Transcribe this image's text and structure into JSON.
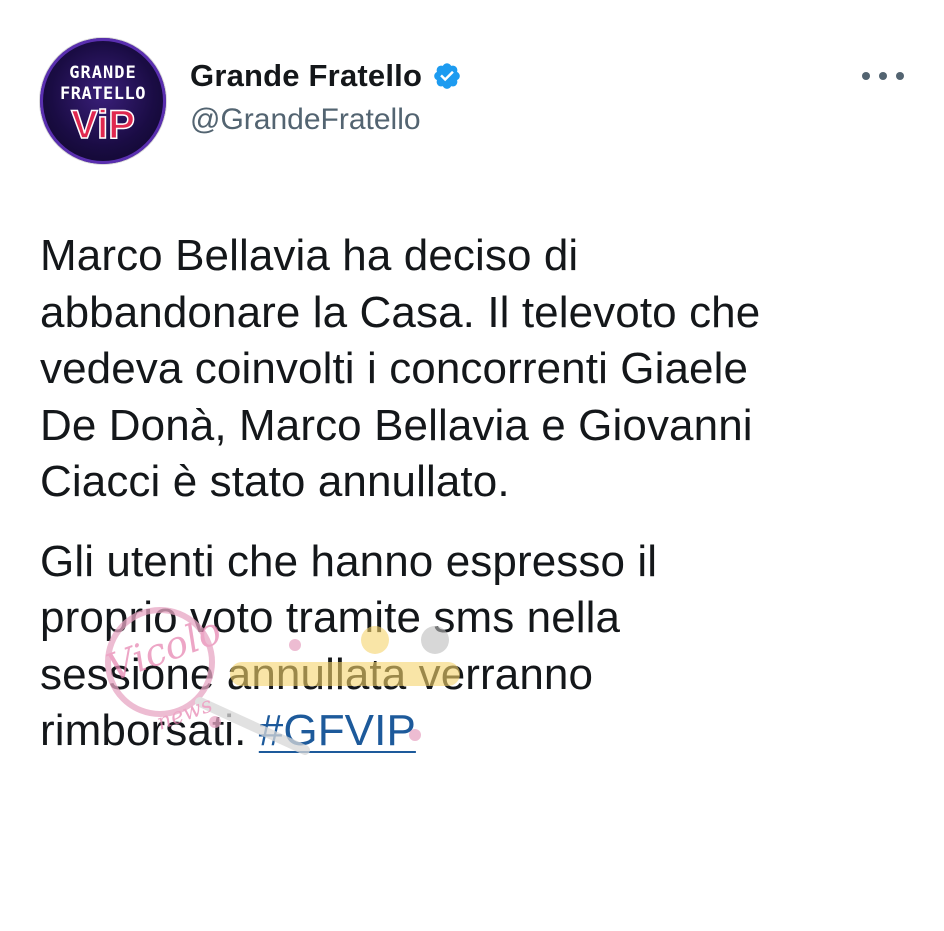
{
  "author": {
    "display_name": "Grande Fratello",
    "handle": "@GrandeFratello",
    "verified": true,
    "avatar_label": "GRANDE FRATELLO VIP"
  },
  "menu": {
    "icon": "more-horizontal-icon"
  },
  "tweet": {
    "paragraph_1": "Marco Bellavia ha deciso di\nabbandonare la Casa. Il televoto che\nvedeva coinvolti i concorrenti Giaele\nDe Donà, Marco Bellavia e Giovanni\nCiacci è stato annullato.",
    "paragraph_2": "Gli utenti che hanno espresso il\nproprio voto tramite sms nella\nsessione annullata verranno\nrimborsati. ",
    "hashtag": "#GFVIP"
  },
  "watermark": {
    "text": "Vicolo delle News"
  },
  "colors": {
    "text": "#14171a",
    "secondary": "#536471",
    "verified": "#1d9bf0",
    "hashtag": "#1d5a9b"
  }
}
